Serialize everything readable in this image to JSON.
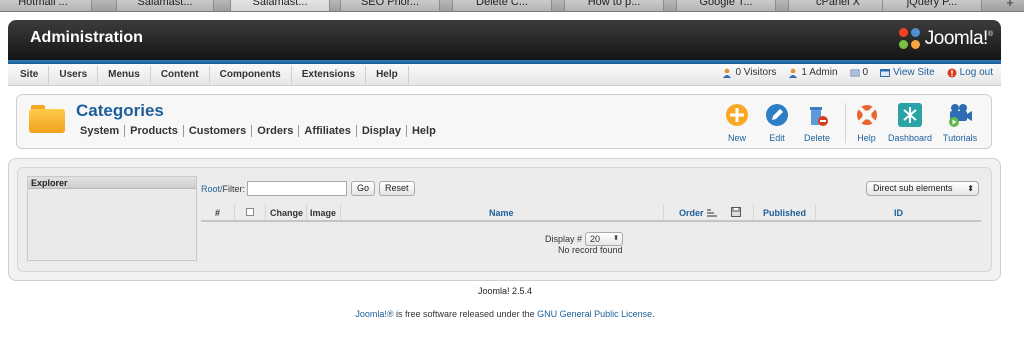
{
  "browser": {
    "tabs": [
      "Hotmail ...",
      "Salamast...",
      "Salamast...",
      "SEO Prior...",
      "Delete C...",
      "How to p...",
      "Google T...",
      "cPanel X",
      "jQuery P..."
    ],
    "new_tab": "+"
  },
  "header": {
    "title": "Administration",
    "logo_text": "Joomla!",
    "logo_mark": "®"
  },
  "menu": {
    "items": [
      "Site",
      "Users",
      "Menus",
      "Content",
      "Components",
      "Extensions",
      "Help"
    ]
  },
  "status": {
    "visitors": "0 Visitors",
    "admins": "1 Admin",
    "messages": "0",
    "view_site": "View Site",
    "logout": "Log out"
  },
  "page": {
    "title": "Categories",
    "submenu": [
      "System",
      "Products",
      "Customers",
      "Orders",
      "Affiliates",
      "Display",
      "Help"
    ]
  },
  "toolbar": {
    "new": "New",
    "edit": "Edit",
    "delete": "Delete",
    "help": "Help",
    "dashboard": "Dashboard",
    "tutorials": "Tutorials"
  },
  "explorer": {
    "title": "Explorer"
  },
  "filter": {
    "root": "Root/",
    "label": "Filter:",
    "value": "",
    "go": "Go",
    "reset": "Reset"
  },
  "view_select": {
    "selected": "Direct sub elements"
  },
  "grid": {
    "columns": {
      "num": "#",
      "change": "Change",
      "image": "Image",
      "name": "Name",
      "order": "Order",
      "published": "Published",
      "id": "ID"
    },
    "display_label": "Display #",
    "display_value": "20",
    "empty": "No record found"
  },
  "footer": {
    "version": "Joomla! 2.5.4",
    "license_prefix": "Joomla!®",
    "license_mid": " is free software released under the ",
    "license_link": "GNU General Public License",
    "license_suffix": "."
  },
  "colors": {
    "link": "#1d5f9a",
    "header_dark": "#151515",
    "accent_blue": "#2f7fc1"
  }
}
